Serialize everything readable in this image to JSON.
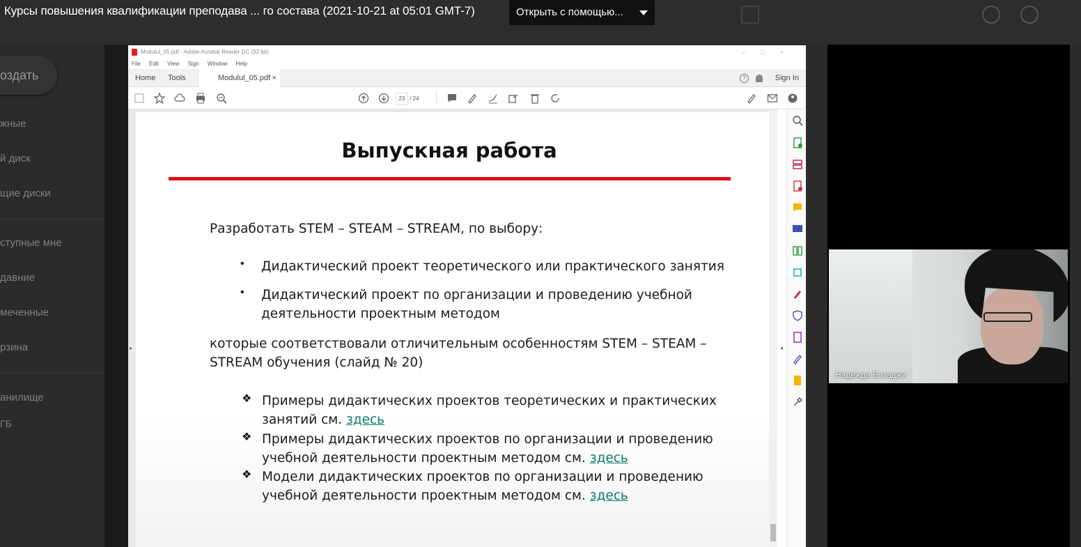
{
  "preview": {
    "title": "Курсы повышения квалификации преподава ... го состава (2021-10-21 at 05:01 GMT-7)",
    "open_with_label": "Открыть с помощью..."
  },
  "drive": {
    "create_label": "оздать",
    "nav": [
      "жные",
      "й диск",
      "щие диски",
      "ступные мне",
      "давние",
      "меченные",
      "рзина",
      "анилище",
      "ГБ"
    ]
  },
  "acrobat": {
    "window_title": "Modulul_05.pdf - Adobe Acrobat Reader DC (32-bit)",
    "menu": [
      "File",
      "Edit",
      "View",
      "Sign",
      "Window",
      "Help"
    ],
    "tabs": {
      "home": "Home",
      "tools": "Tools",
      "doc": "Modulul_05.pdf",
      "close": "×"
    },
    "sign_in": "Sign In",
    "page_current": "23",
    "page_total": "/ 24"
  },
  "slide": {
    "title": "Выпускная работа",
    "intro": "Разработать STEM – STEAM – STREAM, по выбору:",
    "bullets": [
      "Дидактический проект теоретического или практического занятия",
      "Дидактический проект по организации и проведению учебной",
      "деятельности проектным методом"
    ],
    "conclusion_1": "которые соответствовали отличительным особенностям STEM – STEAM –",
    "conclusion_2": "STREAM обучения (слайд № 20)",
    "examples": [
      {
        "line1": "Примеры дидактических проектов теоретических и практических",
        "line2": "занятий см. ",
        "link": "здесь"
      },
      {
        "line1": "Примеры дидактических проектов по организации и проведению",
        "line2": "учебной деятельности проектным методом см. ",
        "link": "здесь"
      },
      {
        "line1": "Модели дидактических проектов по организации и проведению",
        "line2": "учебной деятельности проектным методом см. ",
        "link": "здесь"
      }
    ],
    "accent_color": "#d11111",
    "link_color": "#0d7a6a"
  },
  "video": {
    "participant_name": "Надежда Бозаджи"
  }
}
